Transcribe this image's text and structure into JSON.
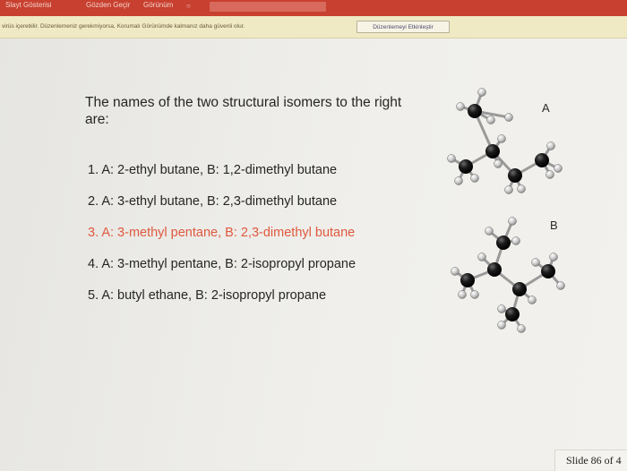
{
  "ribbon": {
    "tabs": [
      "Slayt Gösterisi",
      "Gözden Geçir",
      "Görünüm"
    ],
    "accent": "#c8402f"
  },
  "message_bar": {
    "text": "virüs içerebilir. Düzenlemeniz gerekmiyorsa, Korumalı Görünümde kalmanız daha güvenli olur.",
    "button_label": "Düzenlemeyi Etkinleştir"
  },
  "slide": {
    "question": "The names of the two structural isomers to the right are:",
    "options": [
      "1. A: 2-ethyl butane,  B:  1,2-dimethyl butane",
      "2. A: 3-ethyl butane,  B:  2,3-dimethyl butane",
      "3. A: 3-methyl pentane,  B:  2,3-dimethyl butane",
      "4. A: 3-methyl pentane,  B:  2-isopropyl propane",
      "5. A: butyl ethane,  B:  2-isopropyl propane"
    ],
    "highlight_color": "#e0593f",
    "molecule_a_label": "A",
    "molecule_b_label": "B"
  },
  "footer": {
    "slide_number": "Slide 86 of 4"
  }
}
